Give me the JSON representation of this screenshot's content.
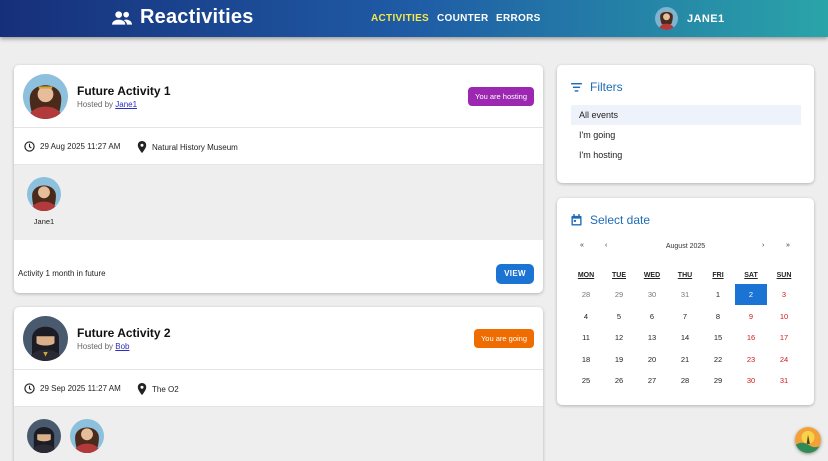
{
  "app": {
    "brand": "Reactivities",
    "nav": [
      {
        "label": "Activities",
        "active": true
      },
      {
        "label": "Counter",
        "active": false
      },
      {
        "label": "Errors",
        "active": false
      }
    ],
    "user": "JANE1"
  },
  "activities": [
    {
      "title": "Future Activity 1",
      "hosted_by_prefix": "Hosted by ",
      "host": "Jane1",
      "badge": "You are hosting",
      "badge_color": "#9c27b0",
      "date": "29 Aug 2025 11:27 AM",
      "venue": "Natural History Museum",
      "attendees": [
        "Jane1"
      ],
      "description": "Activity 1 month in future",
      "view_label": "VIEW"
    },
    {
      "title": "Future Activity 2",
      "hosted_by_prefix": "Hosted by ",
      "host": "Bob",
      "badge": "You are going",
      "badge_color": "#ef6c00",
      "date": "29 Sep 2025 11:27 AM",
      "venue": "The O2",
      "attendees": [
        "",
        ""
      ]
    }
  ],
  "filters": {
    "title": "Filters",
    "items": [
      "All events",
      "I'm going",
      "I'm hosting"
    ],
    "selected": "All events"
  },
  "calendar": {
    "title": "Select date",
    "month_label": "August 2025",
    "nav": {
      "prev_year": "«",
      "prev_month": "‹",
      "next_month": "›",
      "next_year": "»"
    },
    "weekdays": [
      "MON",
      "TUE",
      "WED",
      "THU",
      "FRI",
      "SAT",
      "SUN"
    ],
    "weeks": [
      [
        "28",
        "29",
        "30",
        "31",
        "1",
        "2",
        "3"
      ],
      [
        "4",
        "5",
        "6",
        "7",
        "8",
        "9",
        "10"
      ],
      [
        "11",
        "12",
        "13",
        "14",
        "15",
        "16",
        "17"
      ],
      [
        "18",
        "19",
        "20",
        "21",
        "22",
        "23",
        "24"
      ],
      [
        "25",
        "26",
        "27",
        "28",
        "29",
        "30",
        "31"
      ]
    ],
    "selected_day": "2",
    "accent": "#1b73d3",
    "weekend_color": "#d11a1a"
  }
}
